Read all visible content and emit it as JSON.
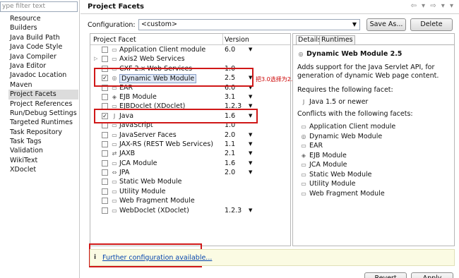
{
  "filter": {
    "placeholder": "ype filter text"
  },
  "nav": [
    "Resource",
    "Builders",
    "Java Build Path",
    "Java Code Style",
    "Java Compiler",
    "Java Editor",
    "Javadoc Location",
    "Maven",
    "Project Facets",
    "Project References",
    "Run/Debug Settings",
    "Targeted Runtimes",
    "Task Repository",
    "Task Tags",
    "Validation",
    "WikiText",
    "XDoclet"
  ],
  "header": {
    "title": "Project Facets",
    "arrows": "⇦ ▾ ⇨ ▾ ▾"
  },
  "config": {
    "label": "Configuration:",
    "value": "<custom>",
    "save_as": "Save As...",
    "delete": "Delete"
  },
  "table": {
    "col_facet": "Project Facet",
    "col_version": "Version",
    "rows": [
      {
        "name": "Application Client module",
        "version": "6.0",
        "dd": "▼"
      },
      {
        "name": "Axis2 Web Services",
        "version": "",
        "dd": ""
      },
      {
        "name": "CXF 2.x Web Services",
        "version": "1.0",
        "dd": ""
      },
      {
        "name": "Dynamic Web Module",
        "version": "2.5",
        "dd": "▼"
      },
      {
        "name": "EAR",
        "version": "6.0",
        "dd": "▼"
      },
      {
        "name": "EJB Module",
        "version": "3.1",
        "dd": "▼"
      },
      {
        "name": "EJBDoclet (XDoclet)",
        "version": "1.2.3",
        "dd": "▼"
      },
      {
        "name": "Java",
        "version": "1.6",
        "dd": "▼"
      },
      {
        "name": "JavaScript",
        "version": "1.0",
        "dd": ""
      },
      {
        "name": "JavaServer Faces",
        "version": "2.0",
        "dd": "▼"
      },
      {
        "name": "JAX-RS (REST Web Services)",
        "version": "1.1",
        "dd": "▼"
      },
      {
        "name": "JAXB",
        "version": "2.1",
        "dd": "▼"
      },
      {
        "name": "JCA Module",
        "version": "1.6",
        "dd": "▼"
      },
      {
        "name": "JPA",
        "version": "2.0",
        "dd": "▼"
      },
      {
        "name": "Static Web Module",
        "version": "",
        "dd": ""
      },
      {
        "name": "Utility Module",
        "version": "",
        "dd": ""
      },
      {
        "name": "Web Fragment Module",
        "version": "",
        "dd": ""
      },
      {
        "name": "WebDoclet (XDoclet)",
        "version": "1.2.3",
        "dd": "▼"
      }
    ]
  },
  "annotation": "把3.0选择为2.5",
  "details": {
    "tab_details": "Details",
    "tab_runtimes": "Runtimes",
    "title": "Dynamic Web Module 2.5",
    "description": "Adds support for the Java Servlet API, for generation of dynamic Web page content.",
    "requires_label": "Requires the following facet:",
    "requires": [
      "Java 1.5 or newer"
    ],
    "conflicts_label": "Conflicts with the following facets:",
    "conflicts": [
      "Application Client module",
      "Dynamic Web Module",
      "EAR",
      "EJB Module",
      "JCA Module",
      "Static Web Module",
      "Utility Module",
      "Web Fragment Module"
    ]
  },
  "further": {
    "info": "i",
    "link": "Further configuration available..."
  },
  "buttons": {
    "revert": "Revert",
    "apply": "Apply"
  },
  "colors": {
    "highlight": "#d01818",
    "link": "#0645ad",
    "info_bg": "#fbfbe3"
  }
}
